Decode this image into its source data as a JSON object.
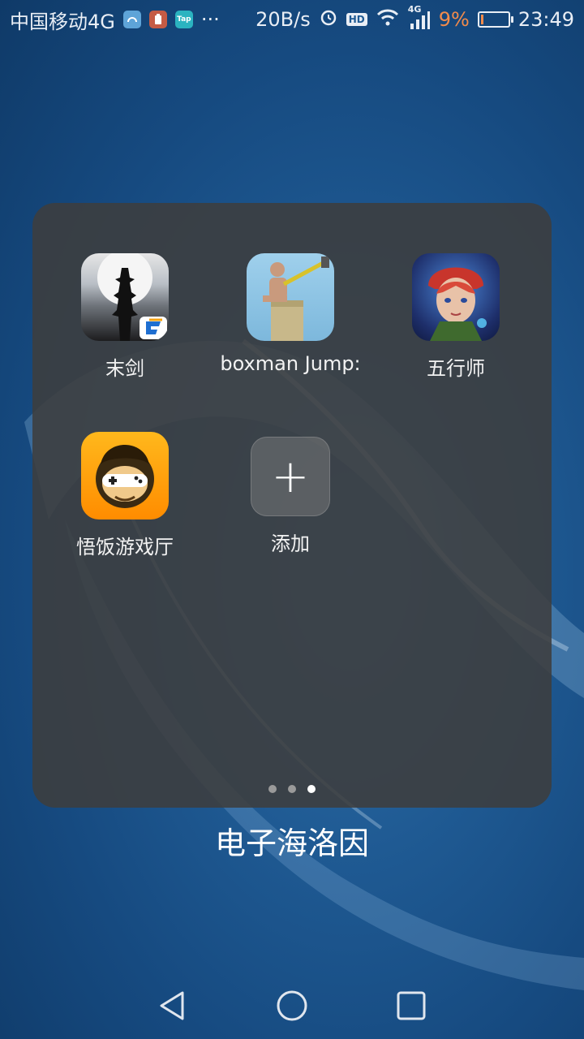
{
  "status_bar": {
    "carrier": "中国移动4G",
    "notif_icons": [
      "browser-icon",
      "battery-saver-icon",
      "taptap-icon"
    ],
    "taptap_label": "Tap",
    "more": "···",
    "net_speed": "20B/s",
    "hd": "HD",
    "net_type": "4G",
    "battery_percent": "9%",
    "battery_level": 0.09,
    "time": "23:49",
    "battery_color": "#f28b4b"
  },
  "folder": {
    "title": "电子海洛因",
    "apps": [
      {
        "label": "末剑",
        "icon": "mojian-app-icon"
      },
      {
        "label": "boxman Jump:",
        "icon": "boxman-jump-app-icon"
      },
      {
        "label": "五行师",
        "icon": "wuxingshi-app-icon"
      },
      {
        "label": "悟饭游戏厅",
        "icon": "wufan-app-icon"
      }
    ],
    "add_label": "添加",
    "add_symbol": "+",
    "pages": 3,
    "active_page": 3
  },
  "nav": [
    "back-icon",
    "home-icon",
    "recents-icon"
  ]
}
